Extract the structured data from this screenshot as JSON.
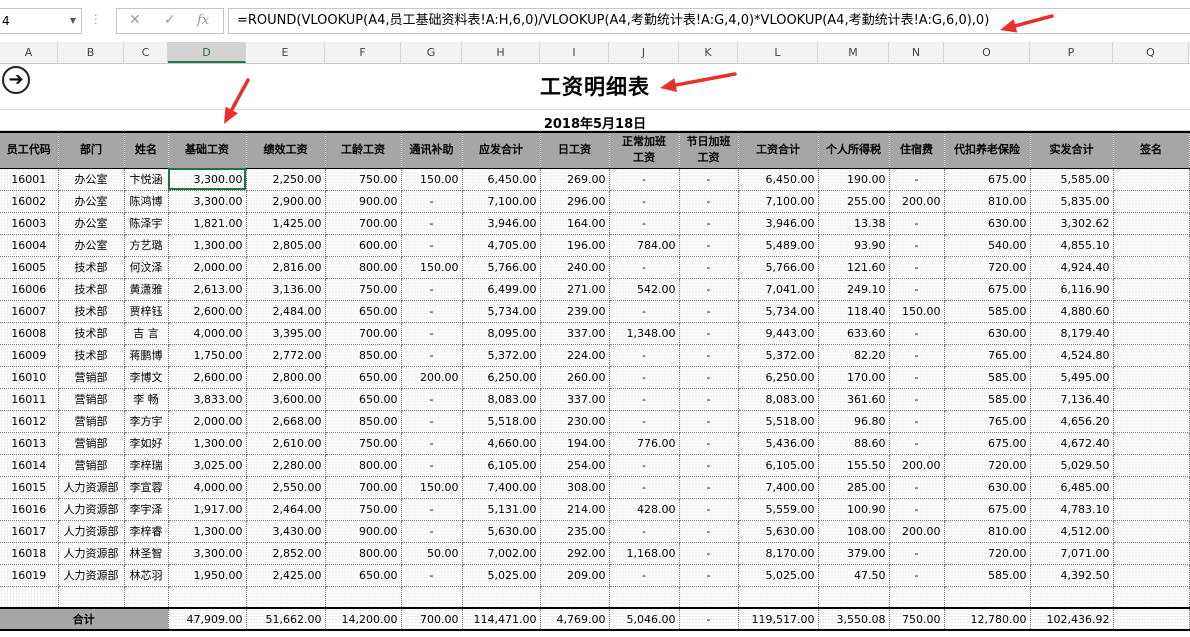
{
  "formula_bar": {
    "name_box": "4",
    "cancel_glyph": "✕",
    "enter_glyph": "✓",
    "fx_glyph": "fx",
    "formula": "=ROUND(VLOOKUP(A4,员工基础资料表!A:H,6,0)/VLOOKUP(A4,考勤统计表!A:G,4,0)*VLOOKUP(A4,考勤统计表!A:G,6,0),0)"
  },
  "column_letters": [
    "A",
    "B",
    "C",
    "D",
    "E",
    "F",
    "G",
    "H",
    "I",
    "J",
    "K",
    "L",
    "M",
    "N",
    "O",
    "P",
    "Q"
  ],
  "selected_column": "D",
  "sheet": {
    "title": "工资明细表",
    "date": "2018年5月18日",
    "headers": [
      "员工代码",
      "部门",
      "姓名",
      "基础工资",
      "绩效工资",
      "工龄工资",
      "通讯补助",
      "应发合计",
      "日工资",
      "正常加班工资",
      "节日加班工资",
      "工资合计",
      "个人所得税",
      "住宿费",
      "代扣养老保险",
      "实发合计",
      "签名"
    ],
    "rows": [
      [
        "16001",
        "办公室",
        "卞悦涵",
        "3,300.00",
        "2,250.00",
        "750.00",
        "150.00",
        "6,450.00",
        "269.00",
        "-",
        "-",
        "6,450.00",
        "190.00",
        "-",
        "675.00",
        "5,585.00",
        ""
      ],
      [
        "16002",
        "办公室",
        "陈鸿博",
        "3,300.00",
        "2,900.00",
        "900.00",
        "-",
        "7,100.00",
        "296.00",
        "-",
        "-",
        "7,100.00",
        "255.00",
        "200.00",
        "810.00",
        "5,835.00",
        ""
      ],
      [
        "16003",
        "办公室",
        "陈泽宇",
        "1,821.00",
        "1,425.00",
        "700.00",
        "-",
        "3,946.00",
        "164.00",
        "-",
        "-",
        "3,946.00",
        "13.38",
        "-",
        "630.00",
        "3,302.62",
        ""
      ],
      [
        "16004",
        "办公室",
        "方艺璐",
        "1,300.00",
        "2,805.00",
        "600.00",
        "-",
        "4,705.00",
        "196.00",
        "784.00",
        "-",
        "5,489.00",
        "93.90",
        "-",
        "540.00",
        "4,855.10",
        ""
      ],
      [
        "16005",
        "技术部",
        "何汶泽",
        "2,000.00",
        "2,816.00",
        "800.00",
        "150.00",
        "5,766.00",
        "240.00",
        "-",
        "-",
        "5,766.00",
        "121.60",
        "-",
        "720.00",
        "4,924.40",
        ""
      ],
      [
        "16006",
        "技术部",
        "黄潇雅",
        "2,613.00",
        "3,136.00",
        "750.00",
        "-",
        "6,499.00",
        "271.00",
        "542.00",
        "-",
        "7,041.00",
        "249.10",
        "-",
        "675.00",
        "6,116.90",
        ""
      ],
      [
        "16007",
        "技术部",
        "贾梓钰",
        "2,600.00",
        "2,484.00",
        "650.00",
        "-",
        "5,734.00",
        "239.00",
        "-",
        "-",
        "5,734.00",
        "118.40",
        "150.00",
        "585.00",
        "4,880.60",
        ""
      ],
      [
        "16008",
        "技术部",
        "吉 言",
        "4,000.00",
        "3,395.00",
        "700.00",
        "-",
        "8,095.00",
        "337.00",
        "1,348.00",
        "-",
        "9,443.00",
        "633.60",
        "-",
        "630.00",
        "8,179.40",
        ""
      ],
      [
        "16009",
        "技术部",
        "蒋鹏博",
        "1,750.00",
        "2,772.00",
        "850.00",
        "-",
        "5,372.00",
        "224.00",
        "-",
        "-",
        "5,372.00",
        "82.20",
        "-",
        "765.00",
        "4,524.80",
        ""
      ],
      [
        "16010",
        "营销部",
        "李博文",
        "2,600.00",
        "2,800.00",
        "650.00",
        "200.00",
        "6,250.00",
        "260.00",
        "-",
        "-",
        "6,250.00",
        "170.00",
        "-",
        "585.00",
        "5,495.00",
        ""
      ],
      [
        "16011",
        "营销部",
        "李 畅",
        "3,833.00",
        "3,600.00",
        "650.00",
        "-",
        "8,083.00",
        "337.00",
        "-",
        "-",
        "8,083.00",
        "361.60",
        "-",
        "585.00",
        "7,136.40",
        ""
      ],
      [
        "16012",
        "营销部",
        "李方宇",
        "2,000.00",
        "2,668.00",
        "850.00",
        "-",
        "5,518.00",
        "230.00",
        "-",
        "-",
        "5,518.00",
        "96.80",
        "-",
        "765.00",
        "4,656.20",
        ""
      ],
      [
        "16013",
        "营销部",
        "李如好",
        "1,300.00",
        "2,610.00",
        "750.00",
        "-",
        "4,660.00",
        "194.00",
        "776.00",
        "-",
        "5,436.00",
        "88.60",
        "-",
        "675.00",
        "4,672.40",
        ""
      ],
      [
        "16014",
        "营销部",
        "李梓瑞",
        "3,025.00",
        "2,280.00",
        "800.00",
        "-",
        "6,105.00",
        "254.00",
        "-",
        "-",
        "6,105.00",
        "155.50",
        "200.00",
        "720.00",
        "5,029.50",
        ""
      ],
      [
        "16015",
        "人力资源部",
        "李宣蓉",
        "4,000.00",
        "2,550.00",
        "700.00",
        "150.00",
        "7,400.00",
        "308.00",
        "-",
        "-",
        "7,400.00",
        "285.00",
        "-",
        "630.00",
        "6,485.00",
        ""
      ],
      [
        "16016",
        "人力资源部",
        "李宇泽",
        "1,917.00",
        "2,464.00",
        "750.00",
        "-",
        "5,131.00",
        "214.00",
        "428.00",
        "-",
        "5,559.00",
        "100.90",
        "-",
        "675.00",
        "4,783.10",
        ""
      ],
      [
        "16017",
        "人力资源部",
        "李梓睿",
        "1,300.00",
        "3,430.00",
        "900.00",
        "-",
        "5,630.00",
        "235.00",
        "-",
        "-",
        "5,630.00",
        "108.00",
        "200.00",
        "810.00",
        "4,512.00",
        ""
      ],
      [
        "16018",
        "人力资源部",
        "林圣智",
        "3,300.00",
        "2,852.00",
        "800.00",
        "50.00",
        "7,002.00",
        "292.00",
        "1,168.00",
        "-",
        "8,170.00",
        "379.00",
        "-",
        "720.00",
        "7,071.00",
        ""
      ],
      [
        "16019",
        "人力资源部",
        "林芯羽",
        "1,950.00",
        "2,425.00",
        "650.00",
        "-",
        "5,025.00",
        "209.00",
        "-",
        "-",
        "5,025.00",
        "47.50",
        "-",
        "585.00",
        "4,392.50",
        ""
      ]
    ],
    "total": {
      "label": "合计",
      "values": [
        "47,909.00",
        "51,662.00",
        "14,200.00",
        "700.00",
        "114,471.00",
        "4,769.00",
        "5,046.00",
        "-",
        "119,517.00",
        "3,550.08",
        "750.00",
        "12,780.00",
        "102,436.92",
        ""
      ]
    }
  },
  "annotation_color": "#e8302a"
}
